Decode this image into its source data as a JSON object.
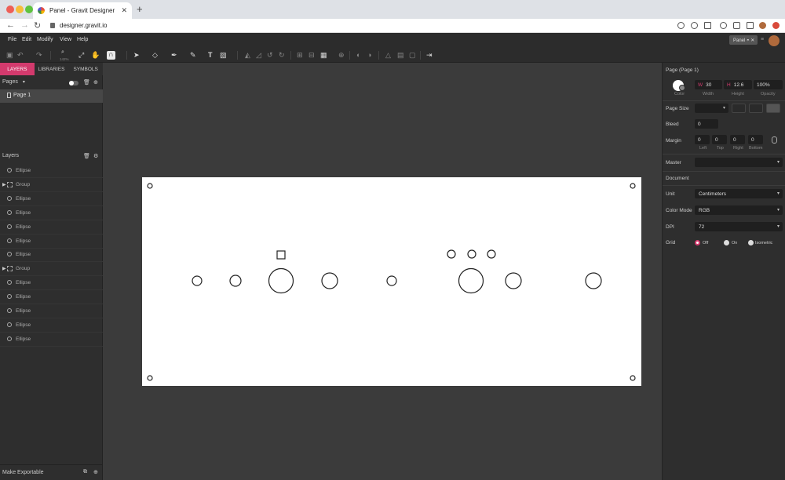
{
  "browser": {
    "tab_title": "Panel - Gravit Designer",
    "tab_close": "✕",
    "new_tab": "+",
    "url": "designer.gravit.io"
  },
  "menu": {
    "items": [
      "File",
      "Edit",
      "Modify",
      "View",
      "Help"
    ],
    "panel_tab": "Panel ◓ ✕"
  },
  "toolbar": {
    "zoom": "142%"
  },
  "left_panel": {
    "tabs": [
      "LAYERS",
      "LIBRARIES",
      "SYMBOLS"
    ],
    "pages_label": "Pages",
    "page_item": "Page 1",
    "layers_label": "Layers",
    "layers": [
      {
        "type": "ellipse",
        "label": "Ellipse"
      },
      {
        "type": "group",
        "label": "Group"
      },
      {
        "type": "ellipse",
        "label": "Ellipse"
      },
      {
        "type": "ellipse",
        "label": "Ellipse"
      },
      {
        "type": "ellipse",
        "label": "Ellipse"
      },
      {
        "type": "ellipse",
        "label": "Ellipse"
      },
      {
        "type": "ellipse",
        "label": "Ellipse"
      },
      {
        "type": "group",
        "label": "Group"
      },
      {
        "type": "ellipse",
        "label": "Ellipse"
      },
      {
        "type": "ellipse",
        "label": "Ellipse"
      },
      {
        "type": "ellipse",
        "label": "Ellipse"
      },
      {
        "type": "ellipse",
        "label": "Ellipse"
      },
      {
        "type": "ellipse",
        "label": "Ellipse"
      }
    ],
    "make_exportable": "Make Exportable"
  },
  "right_panel": {
    "title": "Page (Page 1)",
    "color_label": "Color",
    "width_prefix": "W",
    "width_value": "30",
    "width_label": "Width",
    "height_prefix": "H",
    "height_value": "12.6",
    "height_label": "Height",
    "opacity_value": "100%",
    "opacity_label": "Opacity",
    "page_size_label": "Page Size",
    "bleed_label": "Bleed",
    "bleed_value": "0",
    "margin_label": "Margin",
    "margins": [
      {
        "value": "0",
        "label": "Left"
      },
      {
        "value": "0",
        "label": "Top"
      },
      {
        "value": "0",
        "label": "Right"
      },
      {
        "value": "0",
        "label": "Bottom"
      }
    ],
    "master_label": "Master",
    "document_label": "Document",
    "unit_label": "Unit",
    "unit_value": "Centimeters",
    "color_mode_label": "Color Mode",
    "color_mode_value": "RGB",
    "dpi_label": "DPI",
    "dpi_value": "72",
    "grid_label": "Grid",
    "grid_options": [
      "Off",
      "On",
      "Isometric"
    ],
    "grid_selected": "Off"
  },
  "colors": {
    "accent": "#d33a6d",
    "panel_bg": "#2e2e2e",
    "canvas_bg": "#3b3b3b"
  }
}
